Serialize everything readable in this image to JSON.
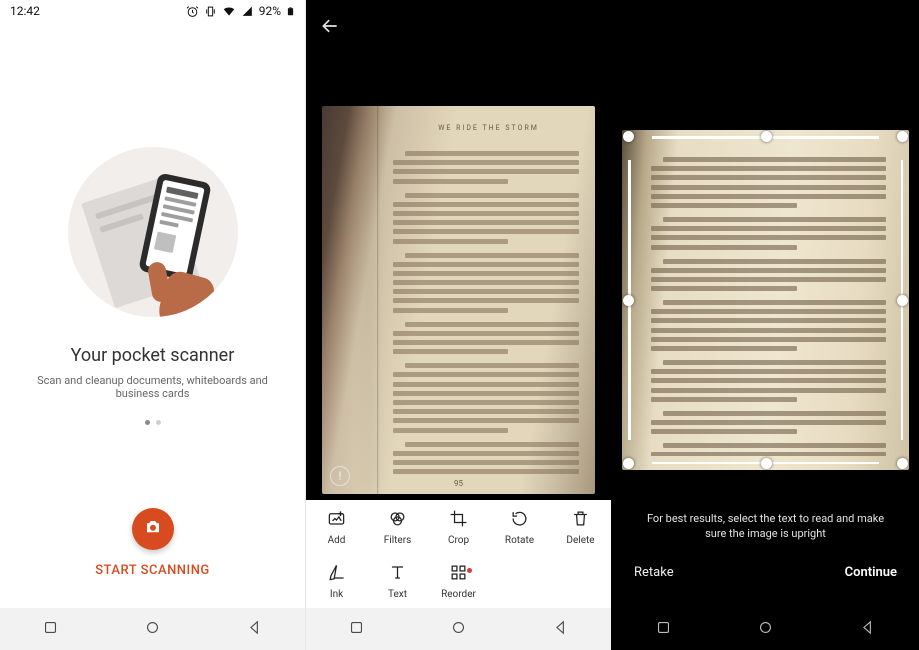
{
  "panel1": {
    "status": {
      "time": "12:42",
      "battery": "92%"
    },
    "hero": {
      "title": "Your pocket scanner",
      "subtitle": "Scan and cleanup documents, whiteboards and business cards"
    },
    "page_dots": {
      "count": 2,
      "active_index": 0
    },
    "start_label": "START SCANNING"
  },
  "panel2": {
    "photo": {
      "running_header": "WE RIDE THE STORM",
      "page_number": "95"
    },
    "tools": {
      "add": "Add",
      "filters": "Filters",
      "crop": "Crop",
      "rotate": "Rotate",
      "delete": "Delete",
      "ink": "Ink",
      "text": "Text",
      "reorder": "Reorder"
    }
  },
  "panel3": {
    "hint": "For best results, select the text to read and make sure the image is upright",
    "actions": {
      "retake": "Retake",
      "continue": "Continue"
    }
  }
}
